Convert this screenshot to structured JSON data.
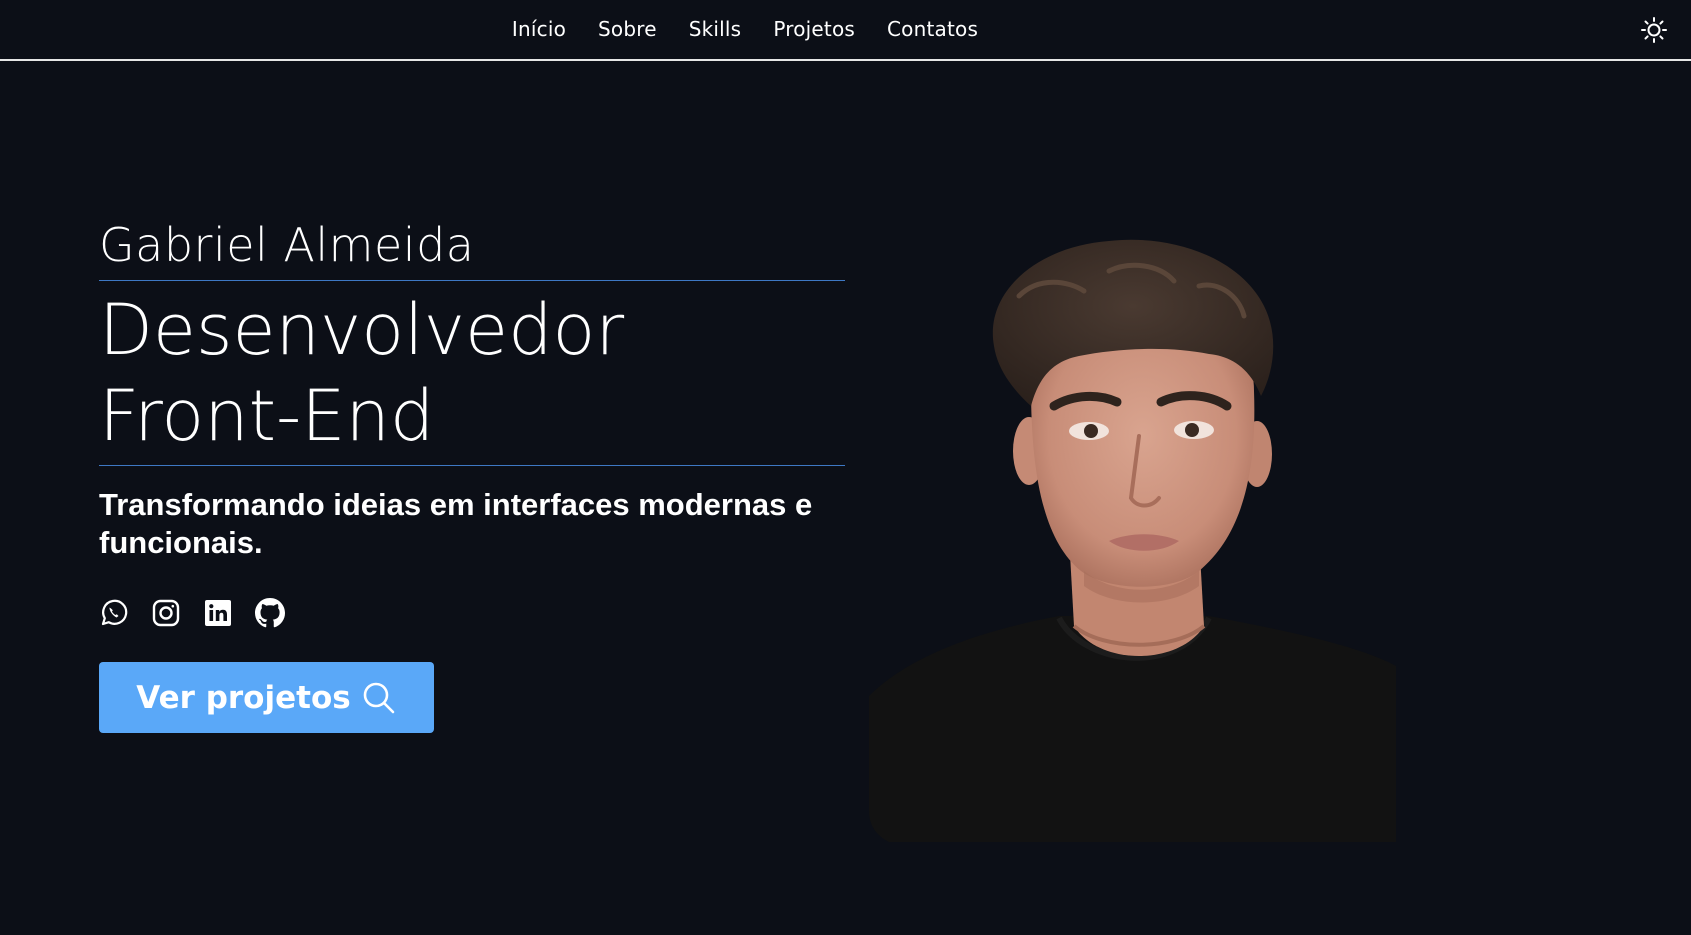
{
  "nav": {
    "items": [
      {
        "label": "Início"
      },
      {
        "label": "Sobre"
      },
      {
        "label": "Skills"
      },
      {
        "label": "Projetos"
      },
      {
        "label": "Contatos"
      }
    ],
    "theme_icon": "sun-icon"
  },
  "hero": {
    "name": "Gabriel Almeida",
    "role_line1": "Desenvolvedor",
    "role_line2": "Front-End",
    "tagline": "Transformando ideias em interfaces modernas e funcionais.",
    "socials": [
      {
        "icon": "whatsapp-icon"
      },
      {
        "icon": "instagram-icon"
      },
      {
        "icon": "linkedin-icon"
      },
      {
        "icon": "github-icon"
      }
    ],
    "cta_label": "Ver projetos",
    "cta_icon": "search-icon"
  },
  "colors": {
    "background": "#0c0f17",
    "accent": "#5aa8f8",
    "rule": "#3e78c4",
    "text": "#ffffff"
  }
}
